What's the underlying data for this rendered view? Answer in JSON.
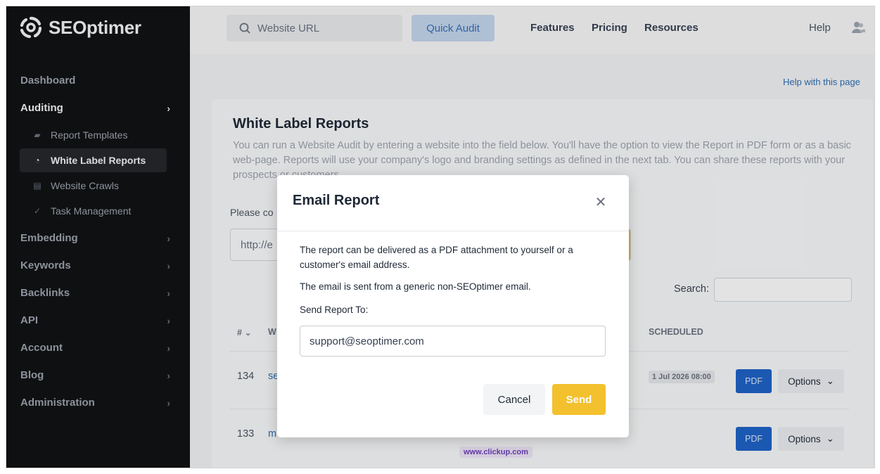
{
  "app": {
    "logo_text": "SEOptimer"
  },
  "sidebar": {
    "items": [
      {
        "label": "Dashboard"
      },
      {
        "label": "Auditing"
      },
      {
        "label": "Embedding"
      },
      {
        "label": "Keywords"
      },
      {
        "label": "Backlinks"
      },
      {
        "label": "API"
      },
      {
        "label": "Account"
      },
      {
        "label": "Blog"
      },
      {
        "label": "Administration"
      }
    ],
    "subitems": [
      {
        "label": "Report Templates"
      },
      {
        "label": "White Label Reports"
      },
      {
        "label": "Website Crawls"
      },
      {
        "label": "Task Management"
      }
    ]
  },
  "topbar": {
    "search_placeholder": "Website URL",
    "quick_audit": "Quick Audit",
    "links": [
      "Features",
      "Pricing",
      "Resources"
    ],
    "help": "Help"
  },
  "page": {
    "help_link": "Help with this page",
    "title": "White Label Reports",
    "description": "You can run a Website Audit by entering a website into the field below. You'll have the option to view the Report in PDF form or as a basic web-page. Reports will use your company's logo and branding settings as defined in the next tab. You can share these reports with your prospects or customers.",
    "prompt_partial": "Please co",
    "url_partial": "http://e",
    "search_label": "Search:",
    "table": {
      "headers": {
        "num": "#",
        "website_partial": "W",
        "scheduled": "SCHEDULED"
      },
      "rows": [
        {
          "num": "134",
          "site_partial": "se",
          "scheduled": "1 Jul 2026 08:00",
          "pdf": "PDF",
          "options": "Options"
        },
        {
          "num": "133",
          "site_partial": "m",
          "domain": "www.clickup.com",
          "pdf": "PDF",
          "options": "Options"
        }
      ]
    }
  },
  "modal": {
    "title": "Email Report",
    "para1": "The report can be delivered as a PDF attachment to yourself or a customer's email address.",
    "para2": "The email is sent from a generic non-SEOptimer email.",
    "send_to_label": "Send Report To:",
    "email_value": "support@seoptimer.com",
    "cancel": "Cancel",
    "send": "Send"
  },
  "colors": {
    "sidebar_bg": "#111214",
    "accent_yellow": "#f3c12e",
    "pdf_blue": "#1f62c7",
    "link_blue": "#2f6fb3"
  }
}
